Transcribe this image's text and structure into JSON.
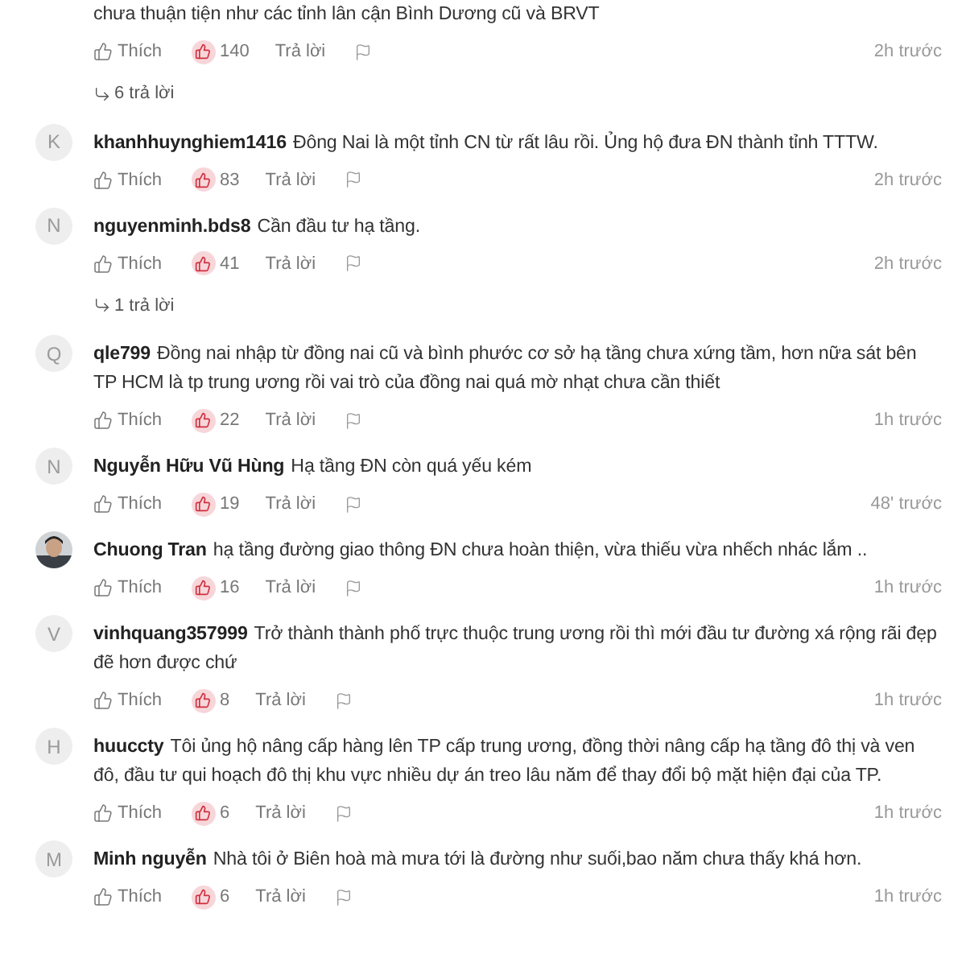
{
  "comments": [
    {
      "text": "chưa thuận tiện như các tỉnh lân cận Bình Dương cũ và BRVT",
      "like_label": "Thích",
      "likes": "140",
      "reply_label": "Trả lời",
      "time": "2h trước",
      "replies": "6 trả lời"
    },
    {
      "author": "khanhhuynghiem1416",
      "avatar": {
        "kind": "letter",
        "letter": "K"
      },
      "text": "Đông Nai là một tỉnh CN từ rất lâu rồi. Ủng hộ đưa ĐN thành tỉnh TTTW.",
      "like_label": "Thích",
      "likes": "83",
      "reply_label": "Trả lời",
      "time": "2h trước"
    },
    {
      "author": "nguyenminh.bds8",
      "avatar": {
        "kind": "letter",
        "letter": "N"
      },
      "text": "Cần đầu tư hạ tầng.",
      "like_label": "Thích",
      "likes": "41",
      "reply_label": "Trả lời",
      "time": "2h trước",
      "replies": "1 trả lời"
    },
    {
      "author": "qle799",
      "avatar": {
        "kind": "letter",
        "letter": "Q"
      },
      "text": "Đồng nai nhập từ đồng nai cũ và bình phước cơ sở hạ tầng chưa xứng tầm, hơn nữa sát bên TP HCM là tp trung ương rồi vai trò của đồng nai quá mờ nhạt chưa cần thiết",
      "like_label": "Thích",
      "likes": "22",
      "reply_label": "Trả lời",
      "time": "1h trước"
    },
    {
      "author": "Nguyễn Hữu Vũ Hùng",
      "avatar": {
        "kind": "letter",
        "letter": "N"
      },
      "text": "Hạ tầng ĐN còn quá yếu kém",
      "like_label": "Thích",
      "likes": "19",
      "reply_label": "Trả lời",
      "time": "48' trước"
    },
    {
      "author": "Chuong Tran",
      "text": "hạ tầng đường giao thông ĐN chưa hoàn thiện, vừa thiếu vừa nhếch nhác lắm ..",
      "like_label": "Thích",
      "likes": "16",
      "reply_label": "Trả lời",
      "time": "1h trước"
    },
    {
      "author": "vinhquang357999",
      "avatar": {
        "kind": "letter",
        "letter": "V"
      },
      "text": "Trở thành thành phố trực thuộc trung ương rồi thì mới đầu tư đường xá rộng rãi đẹp đẽ hơn được chứ",
      "like_label": "Thích",
      "likes": "8",
      "reply_label": "Trả lời",
      "time": "1h trước"
    },
    {
      "author": "huuccty",
      "avatar": {
        "kind": "letter",
        "letter": "H"
      },
      "text": "Tôi ủng hộ nâng cấp hàng lên TP cấp trung ương, đồng thời nâng cấp hạ tầng đô thị và ven đô, đầu tư qui hoạch đô thị khu vực nhiều dự án treo lâu năm để thay đổi bộ mặt hiện đại của TP.",
      "like_label": "Thích",
      "likes": "6",
      "reply_label": "Trả lời",
      "time": "1h trước"
    },
    {
      "author": "Minh nguyễn",
      "avatar": {
        "kind": "letter",
        "letter": "M"
      },
      "text": "Nhà tôi ở Biên hoà mà mưa tới là đường như suối,bao năm chưa thấy khá hơn.",
      "like_label": "Thích",
      "likes": "6",
      "reply_label": "Trả lời",
      "time": "1h trước"
    }
  ]
}
